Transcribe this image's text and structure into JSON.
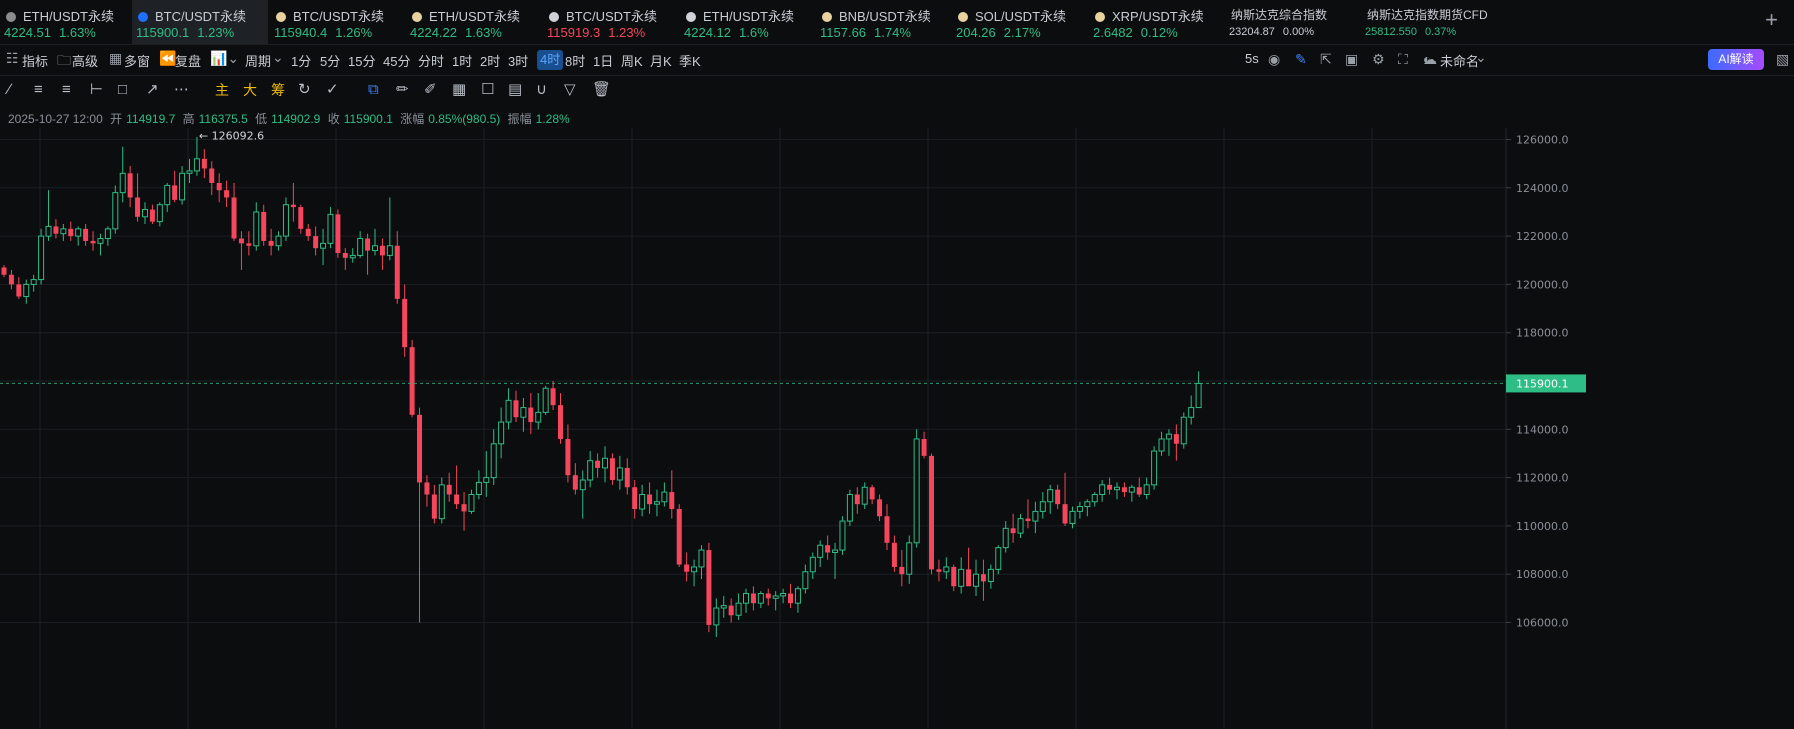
{
  "tickers": [
    {
      "name": "ETH/USDT永续",
      "price": "4224.51",
      "change": "1.63%",
      "dir": "up",
      "icon": "eth-icon",
      "icon_color": "#8c8c8c"
    },
    {
      "name": "BTC/USDT永续",
      "price": "115900.1",
      "change": "1.23%",
      "dir": "up",
      "icon": "exchange-drop-icon",
      "icon_color": "#1e6fff",
      "active": true
    },
    {
      "name": "BTC/USDT永续",
      "price": "115940.4",
      "change": "1.26%",
      "dir": "up",
      "icon": "coin-icon",
      "icon_color": "#e8d3a0"
    },
    {
      "name": "ETH/USDT永续",
      "price": "4224.22",
      "change": "1.63%",
      "dir": "up",
      "icon": "coin-icon",
      "icon_color": "#e8d3a0"
    },
    {
      "name": "BTC/USDT永续",
      "price": "115919.3",
      "change": "1.23%",
      "dir": "down",
      "icon": "cross-icon",
      "icon_color": "#cfd3d8"
    },
    {
      "name": "ETH/USDT永续",
      "price": "4224.12",
      "change": "1.6%",
      "dir": "up",
      "icon": "cross-icon",
      "icon_color": "#cfd3d8"
    },
    {
      "name": "BNB/USDT永续",
      "price": "1157.66",
      "change": "1.74%",
      "dir": "up",
      "icon": "coin-icon",
      "icon_color": "#e8d3a0"
    },
    {
      "name": "SOL/USDT永续",
      "price": "204.26",
      "change": "2.17%",
      "dir": "up",
      "icon": "coin-icon",
      "icon_color": "#e8d3a0"
    },
    {
      "name": "XRP/USDT永续",
      "price": "2.6482",
      "change": "0.12%",
      "dir": "up",
      "icon": "coin-icon",
      "icon_color": "#e8d3a0"
    },
    {
      "name": "纳斯达克综合指数",
      "price": "23204.87",
      "change": "0.00%",
      "dir": "flat",
      "index": true
    },
    {
      "name": "纳斯达克指数期货CFD",
      "price": "25812.550",
      "change": "0.37%",
      "dir": "up",
      "index": true
    }
  ],
  "toolbar": {
    "indicators": "指标",
    "advanced": "高级",
    "multi_window": "多窗",
    "replay": "复盘",
    "period": "周期",
    "intervals": [
      "1分",
      "5分",
      "15分",
      "45分",
      "分时",
      "1时",
      "2时",
      "3时",
      "4时",
      "8时",
      "1日",
      "周K",
      "月K",
      "季K"
    ],
    "selected_interval": "4时",
    "refresh": "5s",
    "layout_name": "未命名",
    "ai_button": "AI解读"
  },
  "drawing_tools": {
    "main": "主",
    "large": "大",
    "chips": "筹"
  },
  "ohlc": {
    "datetime": "2025-10-27 12:00",
    "open_label": "开",
    "open": "114919.7",
    "high_label": "高",
    "high": "116375.5",
    "low_label": "低",
    "low": "114902.9",
    "close_label": "收",
    "close": "115900.1",
    "change_label": "涨幅",
    "change": "0.85%(980.5)",
    "amplitude_label": "振幅",
    "amplitude": "1.28%"
  },
  "chart_data": {
    "type": "candlestick",
    "symbol": "BTC/USDT永续",
    "interval": "4时",
    "y_ticks": [
      "126000.0",
      "124000.0",
      "122000.0",
      "120000.0",
      "118000.0",
      "116000.0",
      "114000.0",
      "112000.0",
      "110000.0",
      "108000.0",
      "106000.0"
    ],
    "ylim": [
      105700,
      126900
    ],
    "last_price": "115900.1",
    "high_marker": "126092.6",
    "colors": {
      "up": "#2ebd85",
      "down": "#f6465d",
      "last_price_line": "#2ebd85",
      "grid": "#1b1e23"
    },
    "candles": [
      [
        120700,
        120800,
        120300,
        120400
      ],
      [
        120400,
        120600,
        119800,
        120000
      ],
      [
        120000,
        120300,
        119400,
        119500
      ],
      [
        119500,
        120200,
        119200,
        120000
      ],
      [
        120000,
        120400,
        119700,
        120200
      ],
      [
        120200,
        122300,
        120000,
        122000
      ],
      [
        122000,
        123900,
        121800,
        122400
      ],
      [
        122400,
        122700,
        121900,
        122100
      ],
      [
        122100,
        122500,
        121800,
        122300
      ],
      [
        122300,
        122600,
        121800,
        122000
      ],
      [
        122000,
        122400,
        121600,
        122300
      ],
      [
        122300,
        122500,
        121600,
        121800
      ],
      [
        121800,
        122200,
        121400,
        121700
      ],
      [
        121700,
        122100,
        121200,
        121900
      ],
      [
        121900,
        122400,
        121600,
        122300
      ],
      [
        122300,
        124100,
        122100,
        123800
      ],
      [
        123800,
        125700,
        123400,
        124600
      ],
      [
        124600,
        124900,
        123200,
        123600
      ],
      [
        123600,
        124600,
        122600,
        122800
      ],
      [
        122800,
        123400,
        122500,
        123100
      ],
      [
        123100,
        123300,
        122500,
        122600
      ],
      [
        122600,
        123400,
        122400,
        123300
      ],
      [
        123300,
        124200,
        123000,
        124100
      ],
      [
        124100,
        124700,
        123400,
        123500
      ],
      [
        123500,
        124900,
        123300,
        124600
      ],
      [
        124600,
        125200,
        124200,
        124700
      ],
      [
        124700,
        126100,
        124500,
        125200
      ],
      [
        125200,
        125600,
        124400,
        124800
      ],
      [
        124800,
        125100,
        123700,
        124200
      ],
      [
        124200,
        124600,
        123400,
        123900
      ],
      [
        123900,
        124300,
        123200,
        123600
      ],
      [
        123600,
        124200,
        121800,
        121900
      ],
      [
        121900,
        122200,
        120600,
        121700
      ],
      [
        121700,
        122200,
        121200,
        121600
      ],
      [
        121600,
        123400,
        121400,
        123000
      ],
      [
        123000,
        123300,
        121600,
        121800
      ],
      [
        121800,
        122300,
        121200,
        121600
      ],
      [
        121600,
        122200,
        121400,
        122000
      ],
      [
        122000,
        123600,
        121800,
        123300
      ],
      [
        123300,
        124200,
        122600,
        123200
      ],
      [
        123200,
        123300,
        122100,
        122300
      ],
      [
        122300,
        122500,
        121800,
        122000
      ],
      [
        122000,
        122400,
        121200,
        121500
      ],
      [
        121500,
        122300,
        120800,
        121700
      ],
      [
        121700,
        123200,
        121500,
        122900
      ],
      [
        122900,
        123100,
        121100,
        121300
      ],
      [
        121300,
        121500,
        120600,
        121100
      ],
      [
        121100,
        121500,
        120900,
        121200
      ],
      [
        121200,
        122200,
        121100,
        121900
      ],
      [
        121900,
        122100,
        120400,
        121400
      ],
      [
        121400,
        122300,
        121200,
        121600
      ],
      [
        121600,
        121900,
        120600,
        121200
      ],
      [
        121200,
        123600,
        121000,
        121600
      ],
      [
        121600,
        122200,
        119200,
        119400
      ],
      [
        119400,
        120000,
        117000,
        117400
      ],
      [
        117400,
        117700,
        114500,
        114600
      ],
      [
        114600,
        114900,
        106000,
        111800
      ],
      [
        111800,
        112100,
        110800,
        111300
      ],
      [
        111300,
        111700,
        110100,
        110300
      ],
      [
        110300,
        112000,
        110100,
        111700
      ],
      [
        111700,
        112200,
        111000,
        111300
      ],
      [
        111300,
        112500,
        110700,
        110900
      ],
      [
        110900,
        111400,
        109800,
        110600
      ],
      [
        110600,
        111500,
        110500,
        111300
      ],
      [
        111300,
        112300,
        111100,
        111800
      ],
      [
        111800,
        113100,
        111200,
        112000
      ],
      [
        112000,
        114000,
        111700,
        113400
      ],
      [
        113400,
        114900,
        112800,
        114300
      ],
      [
        114300,
        115700,
        114000,
        115200
      ],
      [
        115200,
        115600,
        114300,
        114500
      ],
      [
        114500,
        115300,
        113900,
        114900
      ],
      [
        114900,
        115500,
        113800,
        114300
      ],
      [
        114300,
        115500,
        114000,
        114700
      ],
      [
        114700,
        115800,
        114600,
        115700
      ],
      [
        115700,
        116000,
        114800,
        115000
      ],
      [
        115000,
        115500,
        113400,
        113600
      ],
      [
        113600,
        114200,
        111800,
        112100
      ],
      [
        112100,
        112600,
        111300,
        111500
      ],
      [
        111500,
        112300,
        110300,
        111900
      ],
      [
        111900,
        113100,
        111600,
        112700
      ],
      [
        112700,
        113000,
        112000,
        112400
      ],
      [
        112400,
        113300,
        111800,
        112800
      ],
      [
        112800,
        113000,
        111700,
        111900
      ],
      [
        111900,
        112900,
        111500,
        112400
      ],
      [
        112400,
        112800,
        111300,
        111600
      ],
      [
        111600,
        111900,
        110300,
        110700
      ],
      [
        110700,
        111700,
        110400,
        111300
      ],
      [
        111300,
        111800,
        110500,
        110900
      ],
      [
        110900,
        111500,
        110400,
        111000
      ],
      [
        111000,
        111800,
        110800,
        111400
      ],
      [
        111400,
        112300,
        110300,
        110700
      ],
      [
        110700,
        110900,
        108300,
        108400
      ],
      [
        108400,
        108900,
        107700,
        108100
      ],
      [
        108100,
        108600,
        107500,
        108300
      ],
      [
        108300,
        109200,
        107800,
        109000
      ],
      [
        109000,
        109300,
        105600,
        105900
      ],
      [
        105900,
        107000,
        105400,
        106600
      ],
      [
        106600,
        107100,
        106200,
        106700
      ],
      [
        106700,
        107000,
        106000,
        106300
      ],
      [
        106300,
        107200,
        106100,
        106800
      ],
      [
        106800,
        107400,
        106400,
        107200
      ],
      [
        107200,
        107500,
        106500,
        106800
      ],
      [
        106800,
        107300,
        106600,
        107200
      ],
      [
        107200,
        107400,
        106700,
        107000
      ],
      [
        107000,
        107300,
        106500,
        107100
      ],
      [
        107100,
        107400,
        106800,
        107200
      ],
      [
        107200,
        107600,
        106600,
        106800
      ],
      [
        106800,
        107500,
        106400,
        107400
      ],
      [
        107400,
        108400,
        107200,
        108100
      ],
      [
        108100,
        108900,
        107800,
        108700
      ],
      [
        108700,
        109400,
        108300,
        109200
      ],
      [
        109200,
        109600,
        108600,
        108900
      ],
      [
        108900,
        109300,
        107800,
        109000
      ],
      [
        109000,
        110400,
        108800,
        110200
      ],
      [
        110200,
        111500,
        110000,
        111300
      ],
      [
        111300,
        111600,
        110500,
        110900
      ],
      [
        110900,
        111800,
        110700,
        111600
      ],
      [
        111600,
        111700,
        110900,
        111100
      ],
      [
        111100,
        111300,
        110200,
        110400
      ],
      [
        110400,
        110900,
        109000,
        109300
      ],
      [
        109300,
        109600,
        108100,
        108300
      ],
      [
        108300,
        109000,
        107500,
        108000
      ],
      [
        108000,
        109600,
        107600,
        109300
      ],
      [
        109300,
        114000,
        109100,
        113600
      ],
      [
        113600,
        113900,
        112800,
        112900
      ],
      [
        112900,
        113000,
        108000,
        108200
      ],
      [
        108200,
        108600,
        107700,
        108100
      ],
      [
        108100,
        108700,
        107800,
        108300
      ],
      [
        108300,
        108400,
        107300,
        107500
      ],
      [
        107500,
        108700,
        107200,
        108200
      ],
      [
        108200,
        109100,
        107700,
        107500
      ],
      [
        107500,
        108600,
        107100,
        108000
      ],
      [
        108000,
        108600,
        106900,
        107700
      ],
      [
        107700,
        108400,
        107400,
        108200
      ],
      [
        108200,
        109200,
        108000,
        109100
      ],
      [
        109100,
        110200,
        108900,
        109900
      ],
      [
        109900,
        110500,
        109300,
        109700
      ],
      [
        109700,
        110500,
        109500,
        110300
      ],
      [
        110300,
        111100,
        109900,
        110200
      ],
      [
        110200,
        111000,
        109700,
        110600
      ],
      [
        110600,
        111400,
        110300,
        111000
      ],
      [
        111000,
        111700,
        110500,
        111500
      ],
      [
        111500,
        111700,
        110700,
        110900
      ],
      [
        110900,
        112200,
        110000,
        110100
      ],
      [
        110100,
        110800,
        109900,
        110600
      ],
      [
        110600,
        111000,
        110300,
        110800
      ],
      [
        110800,
        111100,
        110400,
        111000
      ],
      [
        111000,
        111400,
        110800,
        111300
      ],
      [
        111300,
        111900,
        111000,
        111700
      ],
      [
        111700,
        112000,
        111300,
        111500
      ],
      [
        111500,
        111800,
        111100,
        111600
      ],
      [
        111600,
        111800,
        111200,
        111400
      ],
      [
        111400,
        111700,
        111000,
        111600
      ],
      [
        111600,
        112000,
        111200,
        111300
      ],
      [
        111300,
        112000,
        111100,
        111700
      ],
      [
        111700,
        113300,
        111500,
        113100
      ],
      [
        113100,
        113900,
        112900,
        113600
      ],
      [
        113600,
        114000,
        112900,
        113800
      ],
      [
        113800,
        114200,
        112700,
        113400
      ],
      [
        113400,
        114700,
        113200,
        114500
      ],
      [
        114500,
        115400,
        114200,
        114900
      ],
      [
        114900,
        116400,
        114900,
        115900
      ]
    ]
  }
}
